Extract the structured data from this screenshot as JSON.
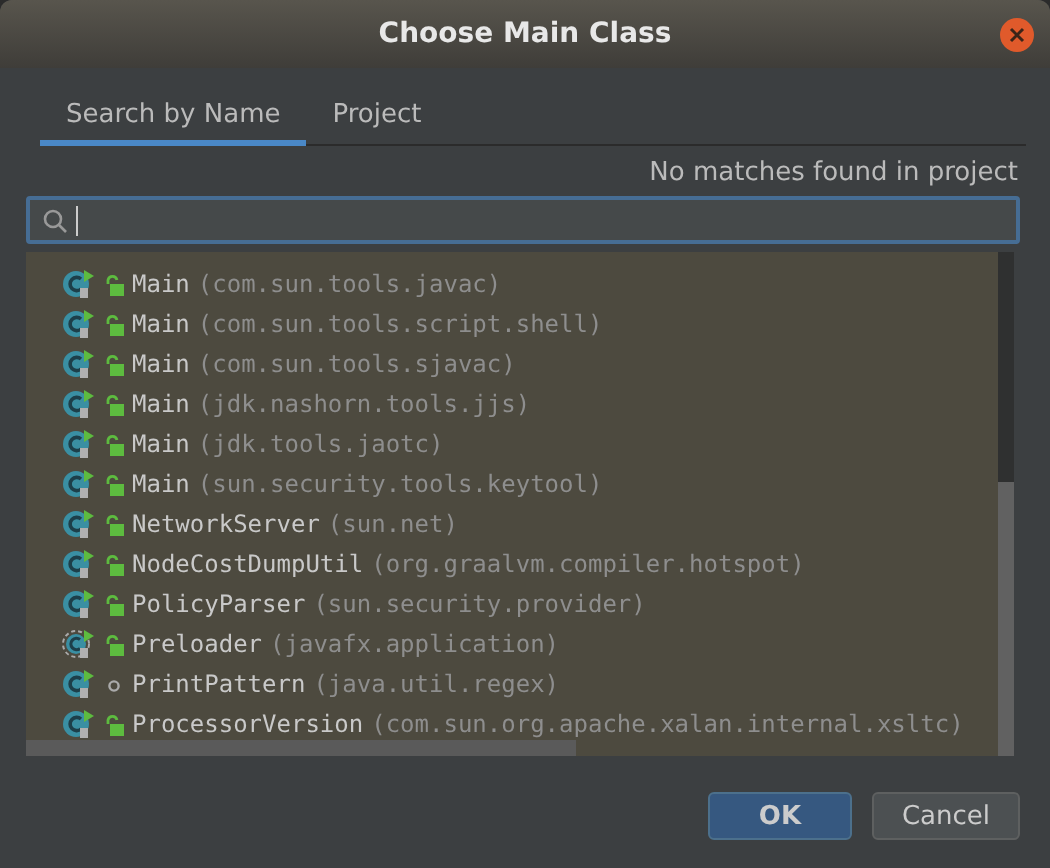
{
  "window": {
    "title": "Choose Main Class"
  },
  "tabs": [
    {
      "label": "Search by Name",
      "selected": true
    },
    {
      "label": "Project",
      "selected": false
    }
  ],
  "status": "No matches found in project",
  "classes": [
    {
      "name": "Main",
      "package": "(com.sun.tools.javac)",
      "kind": "public"
    },
    {
      "name": "Main",
      "package": "(com.sun.tools.script.shell)",
      "kind": "public"
    },
    {
      "name": "Main",
      "package": "(com.sun.tools.sjavac)",
      "kind": "public"
    },
    {
      "name": "Main",
      "package": "(jdk.nashorn.tools.jjs)",
      "kind": "public"
    },
    {
      "name": "Main",
      "package": "(jdk.tools.jaotc)",
      "kind": "public"
    },
    {
      "name": "Main",
      "package": "(sun.security.tools.keytool)",
      "kind": "public"
    },
    {
      "name": "NetworkServer",
      "package": "(sun.net)",
      "kind": "public"
    },
    {
      "name": "NodeCostDumpUtil",
      "package": "(org.graalvm.compiler.hotspot)",
      "kind": "public"
    },
    {
      "name": "PolicyParser",
      "package": "(sun.security.provider)",
      "kind": "public"
    },
    {
      "name": "Preloader",
      "package": "(javafx.application)",
      "kind": "abstract"
    },
    {
      "name": "PrintPattern",
      "package": "(java.util.regex)",
      "kind": "package"
    },
    {
      "name": "ProcessorVersion",
      "package": "(com.sun.org.apache.xalan.internal.xsltc)",
      "kind": "public"
    }
  ],
  "buttons": [
    {
      "label": "OK",
      "kind": "primary"
    },
    {
      "label": "Cancel",
      "kind": "secondary"
    }
  ]
}
